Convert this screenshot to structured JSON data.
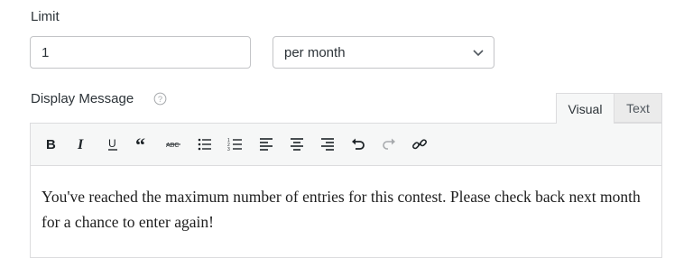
{
  "limit": {
    "label": "Limit",
    "value": "1",
    "period_selected": "per month"
  },
  "display_message": {
    "label": "Display Message",
    "help_icon": "question-circle-icon"
  },
  "editor": {
    "tabs": [
      {
        "label": "Visual",
        "active": true
      },
      {
        "label": "Text",
        "active": false
      }
    ],
    "toolbar": [
      {
        "name": "bold",
        "icon": "bold-icon"
      },
      {
        "name": "italic",
        "icon": "italic-icon"
      },
      {
        "name": "underline",
        "icon": "underline-icon"
      },
      {
        "name": "blockquote",
        "icon": "quote-icon"
      },
      {
        "name": "strikethrough",
        "icon": "strikethrough-icon"
      },
      {
        "name": "bulleted-list",
        "icon": "bulleted-list-icon"
      },
      {
        "name": "numbered-list",
        "icon": "numbered-list-icon"
      },
      {
        "name": "align-left",
        "icon": "align-left-icon"
      },
      {
        "name": "align-center",
        "icon": "align-center-icon"
      },
      {
        "name": "align-right",
        "icon": "align-right-icon"
      },
      {
        "name": "undo",
        "icon": "undo-icon"
      },
      {
        "name": "redo",
        "icon": "redo-icon"
      },
      {
        "name": "link",
        "icon": "link-icon"
      }
    ],
    "content": "You've reached the maximum number of entries for this contest. Please check back next month for a chance to enter again!"
  }
}
